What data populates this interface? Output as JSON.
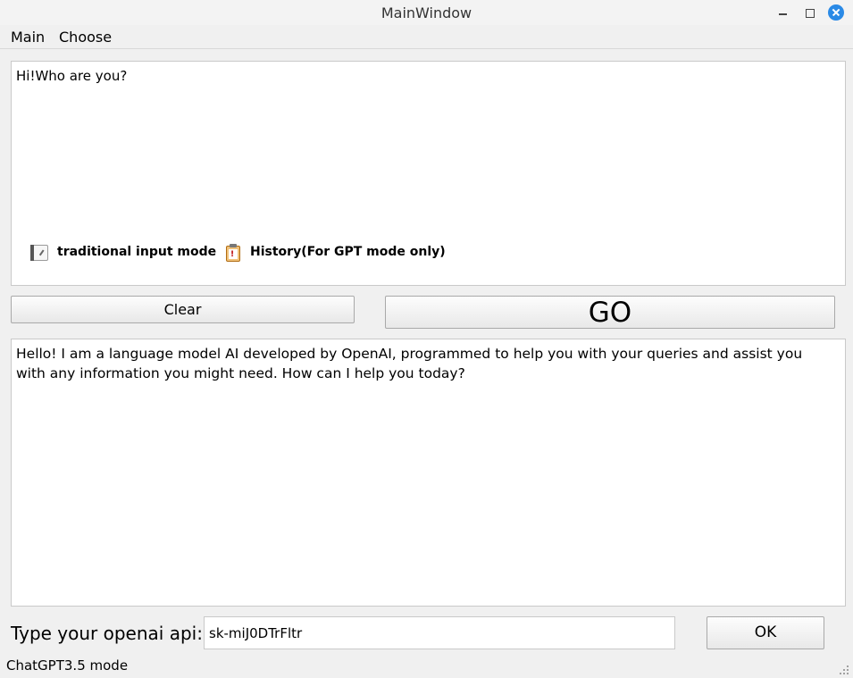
{
  "window": {
    "title": "MainWindow"
  },
  "menu": {
    "main": "Main",
    "choose": "Choose"
  },
  "input": {
    "text": "Hi!Who are you?",
    "traditional_mode": "traditional input mode",
    "history_mode": "History(For GPT mode only)"
  },
  "buttons": {
    "clear": "Clear",
    "go": "GO",
    "ok": "OK"
  },
  "output": {
    "text": "Hello! I am a language model AI developed by OpenAI, programmed to help you with your queries and assist you with any information you might need. How can I help you today?"
  },
  "api": {
    "label": "Type your openai api:",
    "value": "sk-miJ0DTrFltr"
  },
  "status": {
    "text": "ChatGPT3.5 mode"
  },
  "icons": {
    "traditional_mode": "pencil-icon",
    "history_mode": "clipboard-icon",
    "close": "close-icon",
    "minimize": "minimize-icon",
    "maximize": "maximize-icon"
  },
  "colors": {
    "close_button": "#2a8ae6"
  }
}
